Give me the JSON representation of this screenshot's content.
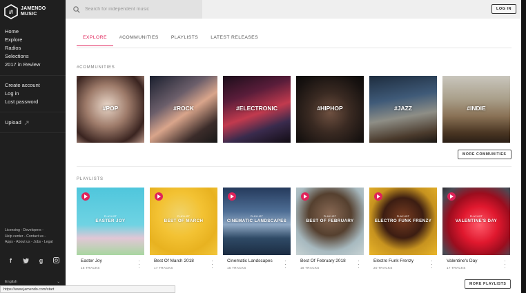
{
  "brand": {
    "name_line1": "JAMENDO",
    "name_line2": "MUSIC"
  },
  "sidebar": {
    "main_items": [
      "Home",
      "Explore",
      "Radios",
      "Selections",
      "2017 in Review"
    ],
    "account_items": [
      "Create account",
      "Log in",
      "Lost password"
    ],
    "upload_label": "Upload",
    "footer_lines": [
      "Licensing - Developers -",
      "Help center - Contact us -",
      "Apps - About us - Jobs - Legal"
    ],
    "social_icons": [
      "facebook-icon",
      "twitter-icon",
      "google-plus-icon",
      "instagram-icon"
    ],
    "language": "English"
  },
  "search": {
    "placeholder": "Search for independent music"
  },
  "topbar": {
    "login_label": "LOG IN"
  },
  "tabs": [
    "EXPLORE",
    "#COMMUNITIES",
    "PLAYLISTS",
    "LATEST RELEASES"
  ],
  "communities": {
    "label": "#COMMUNITIES",
    "items": [
      "#POP",
      "#ROCK",
      "#ELECTRONIC",
      "#HIPHOP",
      "#JAZZ",
      "#INDIE"
    ],
    "more_label": "MORE COMMUNITIES"
  },
  "playlists": {
    "label": "PLAYLISTS",
    "cover_kicker": "PLAYLIST",
    "items": [
      {
        "cover_title": "EASTER JOY",
        "name": "Easter Joy",
        "tracks": "15 TRACKS"
      },
      {
        "cover_title": "BEST OF MARCH",
        "name": "Best Of March 2018",
        "tracks": "17 TRACKS"
      },
      {
        "cover_title": "CINEMATIC LANDSCAPES",
        "name": "Cinematic Landscapes",
        "tracks": "15 TRACKS"
      },
      {
        "cover_title": "BEST OF FEBRUARY",
        "name": "Best Of February 2018",
        "tracks": "18 TRACKS"
      },
      {
        "cover_title": "ELECTRO FUNK FRENZY",
        "name": "Electro Funk Frenzy",
        "tracks": "20 TRACKS"
      },
      {
        "cover_title": "VALENTINE'S DAY",
        "name": "Valentine's Day",
        "tracks": "17 TRACKS"
      }
    ],
    "more_label": "MORE PLAYLISTS"
  },
  "status_bar": {
    "url": "https://www.jamendo.com/start"
  },
  "colors": {
    "accent": "#e0235a",
    "sidebar_bg": "#1f1f1f"
  }
}
